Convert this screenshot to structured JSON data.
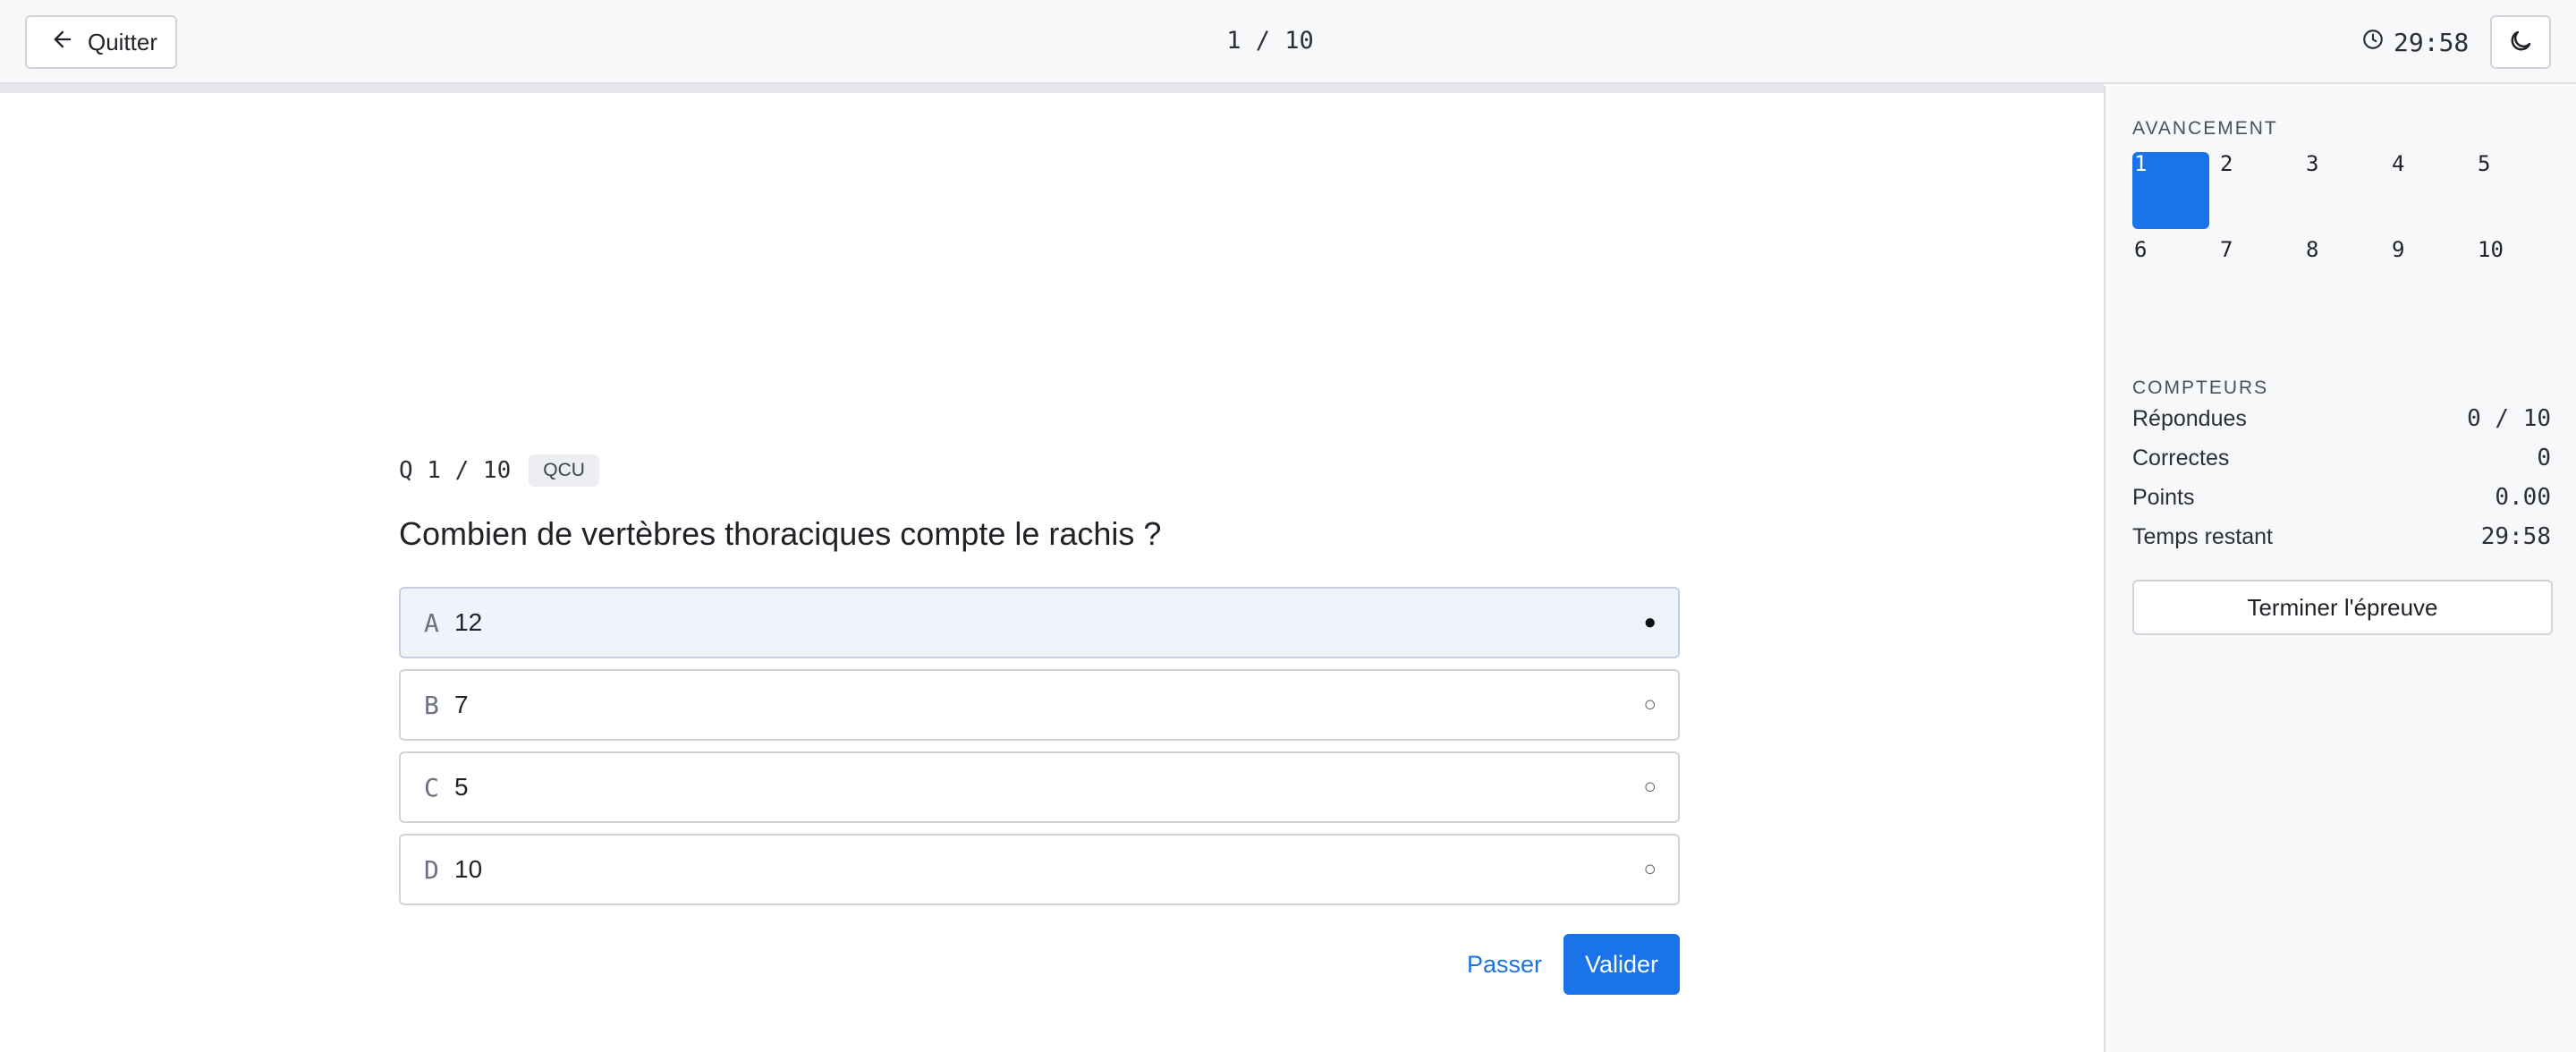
{
  "header": {
    "quit_label": "Quitter",
    "position": "1 / 10",
    "timer": "29:58",
    "progress_fraction": 0.0
  },
  "question": {
    "number": "Q 1 / 10",
    "type": "QCU",
    "text": "Combien de vertèbres thoraciques compte le rachis ?",
    "choices": [
      {
        "letter": "A",
        "text": "12",
        "selected": true,
        "marker": "●"
      },
      {
        "letter": "B",
        "text": "7",
        "selected": false,
        "marker": "○"
      },
      {
        "letter": "C",
        "text": "5",
        "selected": false,
        "marker": "○"
      },
      {
        "letter": "D",
        "text": "10",
        "selected": false,
        "marker": "○"
      }
    ]
  },
  "actions": {
    "skip_label": "Passer",
    "validate_label": "Valider"
  },
  "sidebar": {
    "progress_title": "AVANCEMENT",
    "questions": [
      "1",
      "2",
      "3",
      "4",
      "5",
      "6",
      "7",
      "8",
      "9",
      "10"
    ],
    "current_question": "1",
    "counters_title": "COMPTEURS",
    "counters": [
      {
        "label": "Répondues",
        "value": "0 / 10"
      },
      {
        "label": "Correctes",
        "value": "0"
      },
      {
        "label": "Points",
        "value": "0.00"
      },
      {
        "label": "Temps restant",
        "value": "29:58"
      }
    ],
    "finish_label": "Terminer l'épreuve"
  },
  "colors": {
    "accent": "#1a73e8",
    "selected_choice_bg": "#eef3fc",
    "sidebar_bg": "#f7f8fa"
  },
  "icons": {
    "quit": "arrow-left-icon",
    "timer": "clock-icon",
    "theme": "moon-icon"
  }
}
